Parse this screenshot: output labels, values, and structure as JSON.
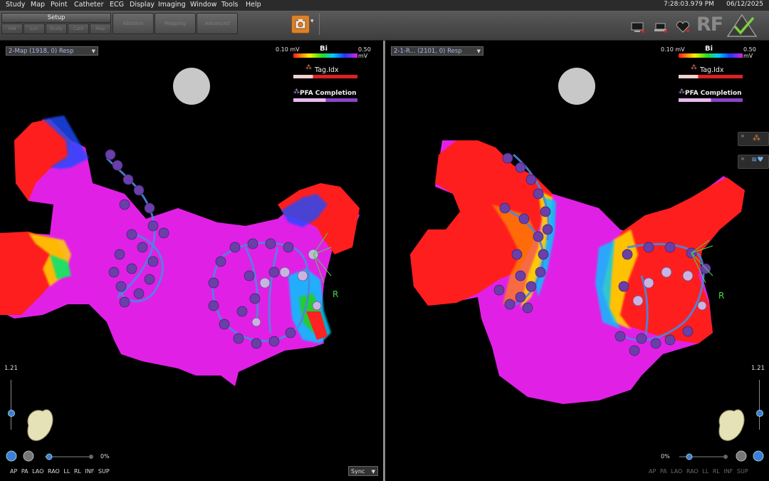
{
  "menu": {
    "items": [
      "Study",
      "Map",
      "Point",
      "Catheter",
      "ECG",
      "Display",
      "Imaging",
      "Window",
      "Tools",
      "Help"
    ],
    "time": "7:28:03.979 PM",
    "date": "06/12/2025"
  },
  "toolbar": {
    "setup_label": "Setup",
    "setup_buttons": [
      "HW",
      "Loc",
      "Study",
      "Cath",
      "Map"
    ],
    "big_buttons": [
      "Ablation",
      "Mapping",
      "Advanced"
    ],
    "camera_icon": "camera-icon",
    "rf_label": "RF"
  },
  "left_pane": {
    "map_select": "2-Map (1918, 0) Resp",
    "legend": {
      "min": "0.10 mV",
      "max": "0.50 mV",
      "title": "Bi",
      "tag_label": "Tag.Idx",
      "pfa_label": "PFA Completion"
    },
    "zoom": "1.21",
    "percent": "0%",
    "views": "AP PA LAO RAO LL RL INF SUP",
    "sync": "Sync",
    "orientation_label": "R"
  },
  "right_pane": {
    "map_select": "2-1-R... (2101, 0) Resp",
    "legend": {
      "min": "0.10 mV",
      "max": "0.50 mV",
      "title": "Bi",
      "tag_label": "Tag.Idx",
      "pfa_label": "PFA Completion"
    },
    "zoom": "1.21",
    "percent": "0%",
    "views": "AP PA LAO RAO LL RL INF SUP",
    "orientation_label": "R"
  },
  "colors": {
    "menubar": "#2b2b2b",
    "map_magenta": "#dd22dd",
    "map_red": "#ff1b1b",
    "catheter_purple": "#6a3fa8"
  }
}
